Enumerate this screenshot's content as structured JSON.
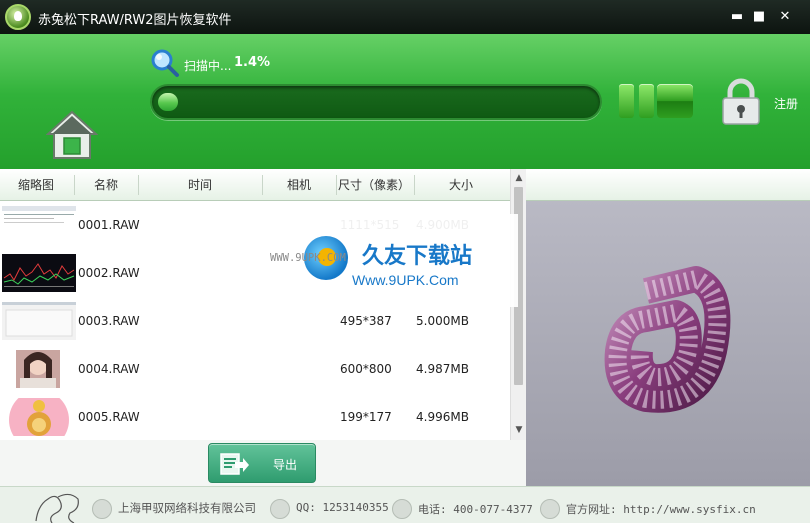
{
  "window": {
    "title": "赤兔松下RAW/RW2图片恢复软件",
    "minimize_glyph": "▬",
    "maximize_glyph": "■",
    "close_glyph": "✕"
  },
  "header": {
    "scan_label": "扫描中...",
    "scan_percent": "1.4%",
    "progress_fraction": 0.014,
    "register_label": "注册"
  },
  "table": {
    "columns": [
      "缩略图",
      "名称",
      "时间",
      "相机",
      "尺寸（像素）",
      "大小"
    ],
    "rows": [
      {
        "name": "0001.RAW",
        "time": "",
        "camera": "",
        "dimensions": "1111*515",
        "size": "4.900MB"
      },
      {
        "name": "0002.RAW",
        "time": "",
        "camera": "",
        "dimensions": "",
        "size": ""
      },
      {
        "name": "0003.RAW",
        "time": "",
        "camera": "",
        "dimensions": "495*387",
        "size": "5.000MB"
      },
      {
        "name": "0004.RAW",
        "time": "",
        "camera": "",
        "dimensions": "600*800",
        "size": "4.987MB"
      },
      {
        "name": "0005.RAW",
        "time": "",
        "camera": "",
        "dimensions": "199*177",
        "size": "4.996MB"
      }
    ]
  },
  "actions": {
    "export_label": "导出"
  },
  "footer": {
    "company": "上海甲驭网络科技有限公司",
    "qq": "QQ: 1253140355",
    "phone": "电话: 400-077-4377",
    "website": "官方网址: http://www.sysfix.cn"
  },
  "watermark": {
    "brand": "久友下载站",
    "url": "Www.9UPK.Com",
    "left_text": "WWW.9UPK.COM"
  },
  "colors": {
    "accent_green": "#31b23a",
    "title_bar": "#141c17",
    "export_green": "#2f9c6f"
  }
}
